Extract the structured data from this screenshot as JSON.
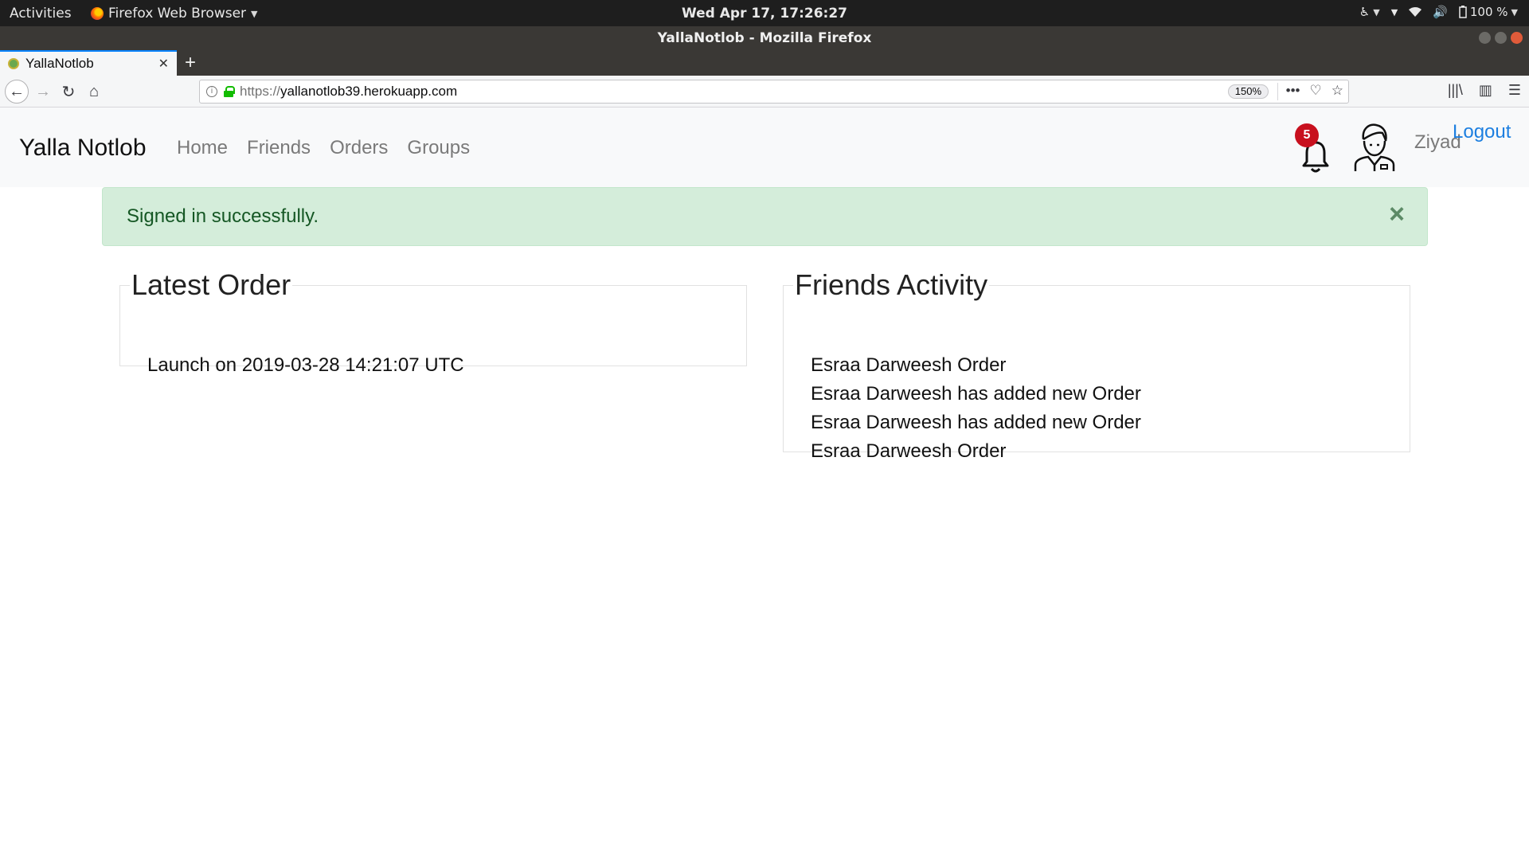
{
  "system_bar": {
    "activities": "Activities",
    "app_name": "Firefox Web Browser",
    "clock": "Wed Apr 17, 17:26:27",
    "battery": "100 %"
  },
  "window": {
    "title": "YallaNotlob - Mozilla Firefox"
  },
  "browser": {
    "tab_title": "YallaNotlob",
    "url_protocol": "https://",
    "url_host": "yallanotlob39.herokuapp.com",
    "zoom": "150%"
  },
  "site": {
    "brand": "Yalla Notlob",
    "nav": {
      "home": "Home",
      "friends": "Friends",
      "orders": "Orders",
      "groups": "Groups"
    },
    "notifications_count": "5",
    "username": "Ziyad",
    "logout": "Logout"
  },
  "alert": {
    "message": "Signed in successfully.",
    "close": "×"
  },
  "latest_order": {
    "title": "Latest Order",
    "items": [
      "Launch on 2019-03-28 14:21:07 UTC"
    ]
  },
  "friends_activity": {
    "title": "Friends Activity",
    "items": [
      "Esraa Darweesh Order",
      "Esraa Darweesh has added new Order",
      "Esraa Darweesh has added new Order",
      "Esraa Darweesh Order"
    ]
  },
  "colors": {
    "alert_bg": "#d4edda",
    "alert_text": "#155724",
    "badge": "#c8101e",
    "logout_link": "#1d7fe0",
    "navbar_bg": "#f8f9fa"
  }
}
